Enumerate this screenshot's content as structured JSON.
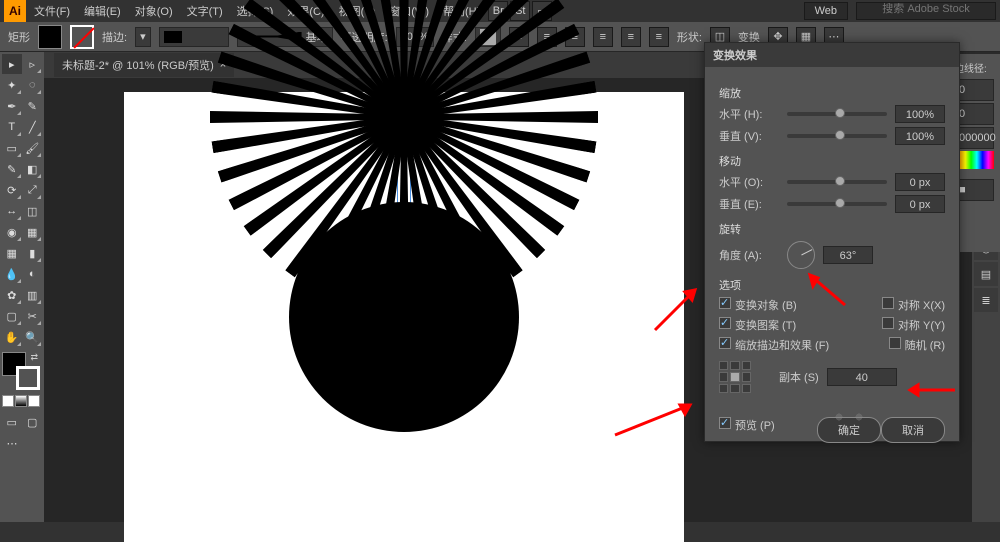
{
  "menu": {
    "items": [
      "文件(F)",
      "编辑(E)",
      "对象(O)",
      "文字(T)",
      "选择(S)",
      "效果(C)",
      "视图(V)",
      "窗口(W)",
      "帮助(H)"
    ]
  },
  "topbar": {
    "workspace": "Web",
    "search_placeholder": "搜索 Adobe Stock"
  },
  "options": {
    "shape_label": "矩形",
    "stroke_label": "描边:",
    "profile_label": "基本",
    "opacity_label": "不透明度:",
    "opacity_value": "100%",
    "style_label": "样式:",
    "shapes_label": "形状:",
    "transform_label": "变换"
  },
  "tab": {
    "title": "未标题-2* @ 101% (RGB/预览)",
    "close": "×"
  },
  "prop_panel": {
    "radius_label": "边线径:",
    "r": "0",
    "g": "0",
    "color": "000000"
  },
  "dialog": {
    "title": "变换效果",
    "scale": {
      "label": "缩放",
      "h_label": "水平 (H):",
      "h_value": "100%",
      "v_label": "垂直 (V):",
      "v_value": "100%"
    },
    "move": {
      "label": "移动",
      "h_label": "水平 (O):",
      "h_value": "0 px",
      "v_label": "垂直 (E):",
      "v_value": "0 px"
    },
    "rotate": {
      "label": "旋转",
      "angle_label": "角度 (A):",
      "angle_value": "63°"
    },
    "options": {
      "label": "选项",
      "transform_obj": "变换对象 (B)",
      "reflect_x": "对称 X(X)",
      "transform_pat": "变换图案 (T)",
      "reflect_y": "对称 Y(Y)",
      "scale_strokes": "缩放描边和效果 (F)",
      "random": "随机 (R)"
    },
    "copies": {
      "label": "副本 (S)",
      "value": "40"
    },
    "preview": "预览 (P)",
    "ok": "确定",
    "cancel": "取消"
  },
  "chart_data": {
    "type": "sunburst-rays",
    "ray_count": 40,
    "angle_step_deg": 9,
    "inner_core_visible": true
  }
}
